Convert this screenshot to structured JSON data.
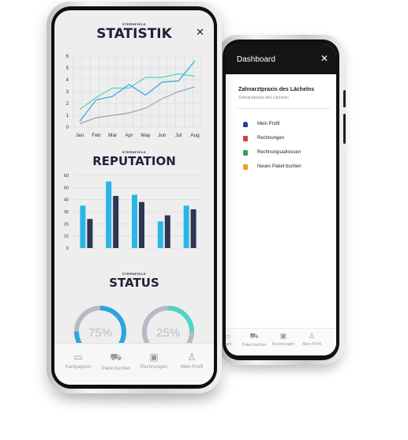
{
  "dashboard": {
    "title": "Dashboard",
    "close_icon": "✕",
    "company_name": "Zahnarztpraxis des Lächelns",
    "company_sub": "Zahnarztpraxis des Lächelns",
    "menu": [
      {
        "label": "Mein Profil",
        "icon": "user-icon",
        "color": "#2b3f8f"
      },
      {
        "label": "Rechnungen",
        "icon": "document-icon",
        "color": "#e23c3c"
      },
      {
        "label": "Rechnungsadressen",
        "icon": "document-icon",
        "color": "#2fa65a"
      },
      {
        "label": "Neues Paket buchen",
        "icon": "document-icon",
        "color": "#f0a020"
      }
    ],
    "tabbar": [
      "agen",
      "Paket buchen",
      "Rechnungen",
      "Mein Profil"
    ]
  },
  "statistik": {
    "brand": "STERNFIELD",
    "title": "STATISTIK",
    "close_icon": "✕",
    "chart_data": {
      "type": "line",
      "x": [
        "Jan",
        "Feb",
        "Mar",
        "Apr",
        "May",
        "Jun",
        "Jul",
        "Aug"
      ],
      "ylim": [
        0,
        6
      ],
      "yticks": [
        0,
        1,
        2,
        3,
        4,
        5,
        6
      ],
      "grid": true,
      "series": [
        {
          "values": [
            1.5,
            2.5,
            3.3,
            3.3,
            4.2,
            4.2,
            4.5,
            4.3
          ],
          "color": "#4dd4c0"
        },
        {
          "values": [
            0.5,
            2.3,
            2.6,
            3.6,
            2.7,
            3.8,
            3.9,
            5.6
          ],
          "color": "#2ea8d8"
        },
        {
          "values": [
            0.3,
            0.8,
            1.0,
            1.2,
            1.6,
            2.4,
            3.0,
            3.4
          ],
          "color": "#9ea3aa"
        }
      ]
    }
  },
  "reputation": {
    "brand": "STERNFIELD",
    "title": "REPUTATION",
    "chart_data": {
      "type": "bar",
      "categories": [
        "",
        "",
        "",
        "",
        ""
      ],
      "ylim": [
        0,
        60
      ],
      "yticks": [
        0,
        10,
        20,
        30,
        40,
        50,
        60
      ],
      "grid": true,
      "series": [
        {
          "values": [
            35,
            55,
            44,
            22,
            35
          ],
          "color": "#29b6e6"
        },
        {
          "values": [
            24,
            43,
            38,
            27,
            32
          ],
          "color": "#2d3753"
        }
      ]
    }
  },
  "status": {
    "brand": "STERNFIELD",
    "title": "STATUS",
    "gauges": [
      {
        "label": "75%",
        "value": 0.75,
        "color": "#2aa7dc",
        "track": "#b6bac4"
      },
      {
        "label": "25%",
        "value": 0.25,
        "color": "#4dd6c4",
        "track": "#b6bac4"
      }
    ]
  },
  "tabbar": [
    {
      "label": "Kampagnen",
      "icon": "chat-icon"
    },
    {
      "label": "Paket buchen",
      "icon": "cart-icon"
    },
    {
      "label": "Rechnungen",
      "icon": "bag-icon"
    },
    {
      "label": "Mein Profil",
      "icon": "user-icon"
    }
  ]
}
